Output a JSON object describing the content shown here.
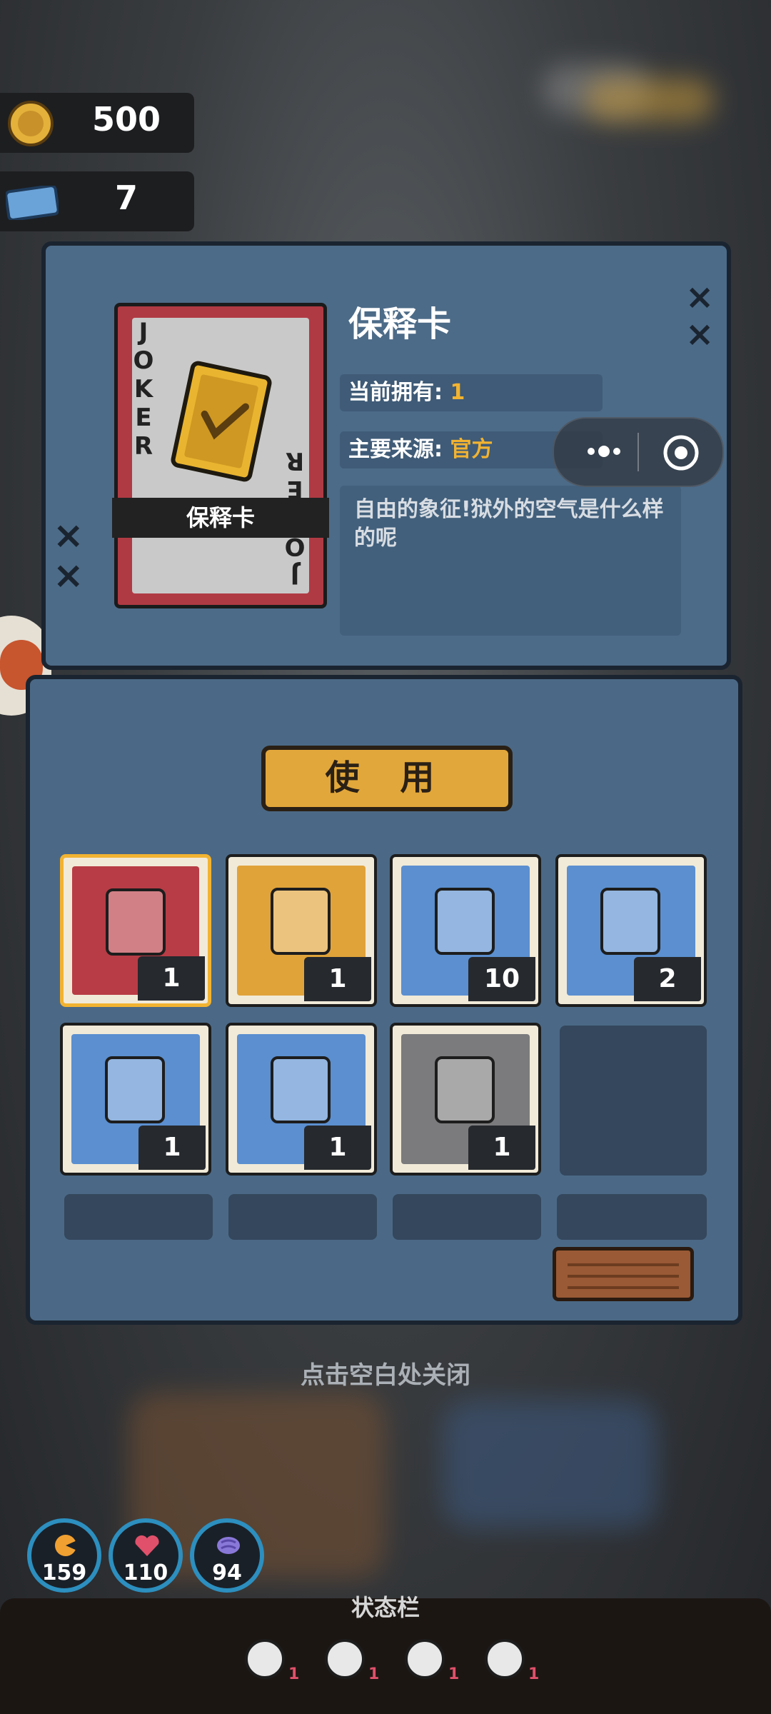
{
  "currency": {
    "coins": {
      "icon": "gold-coin-icon",
      "value": "500"
    },
    "tickets": {
      "icon": "blue-ticket-icon",
      "value": "7"
    }
  },
  "detail": {
    "card_joker_text": "JOKER",
    "card_label": "保释卡",
    "title": "保释卡",
    "owned_label": "当前拥有:",
    "owned_value": "1",
    "source_label": "主要来源:",
    "source_value": "官方",
    "description": "自由的象征!狱外的空气是什么样的呢"
  },
  "use_button": "使 用",
  "inventory": [
    {
      "icon": "bail-card-icon",
      "count": "1",
      "bg": "#b83c45",
      "selected": true
    },
    {
      "icon": "bail-card-star-icon",
      "count": "1",
      "bg": "#e0a33a",
      "selected": false
    },
    {
      "icon": "photo-card-icon",
      "count": "10",
      "bg": "#5b8fd0",
      "selected": false
    },
    {
      "icon": "red-token-icon",
      "count": "2",
      "bg": "#5b8fd0",
      "selected": false
    },
    {
      "icon": "toilet-paper-icon",
      "count": "1",
      "bg": "#5b8fd0",
      "selected": false
    },
    {
      "icon": "snack-bag-icon",
      "count": "1",
      "bg": "#5b8fd0",
      "selected": false
    },
    {
      "icon": "document-envelope-icon",
      "count": "1",
      "bg": "#7b7b7d",
      "selected": false
    }
  ],
  "close_hint": "点击空白处关闭",
  "stats": [
    {
      "icon": "food-icon",
      "value": "159"
    },
    {
      "icon": "heart-icon",
      "value": "110"
    },
    {
      "icon": "brain-icon",
      "value": "94"
    }
  ],
  "status_bar": {
    "title": "状态栏",
    "items": [
      {
        "icon": "masks-icon",
        "count": "1"
      },
      {
        "icon": "bandage-icon",
        "count": "1"
      },
      {
        "icon": "tired-person-icon",
        "count": "1"
      },
      {
        "icon": "flame-hand-icon",
        "count": "1"
      }
    ]
  },
  "colors": {
    "accent": "#f2b331",
    "panel": "#4c6b88",
    "card_red": "#b03a43"
  }
}
